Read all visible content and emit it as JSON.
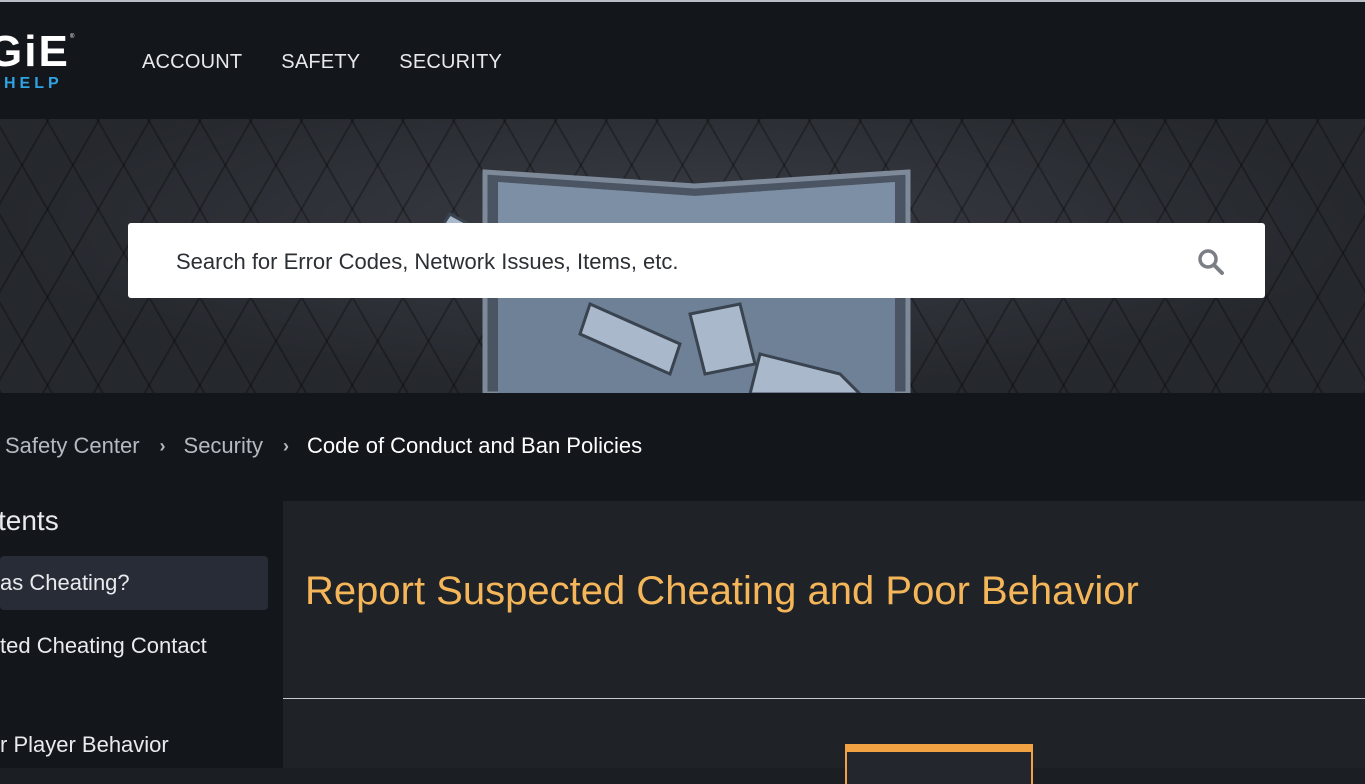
{
  "logo": {
    "main": "GiE",
    "sub": "HELP"
  },
  "nav": {
    "items": [
      "ACCOUNT",
      "SAFETY",
      "SECURITY"
    ]
  },
  "search": {
    "placeholder": "Search for Error Codes, Network Issues, Items, etc.",
    "icon": "search-icon"
  },
  "breadcrumb": {
    "items": [
      "Safety Center",
      "Security"
    ],
    "current": "Code of Conduct and Ban Policies"
  },
  "sidebar": {
    "title": "tents",
    "items": [
      "as Cheating?",
      "ted Cheating Contact",
      "r Player Behavior"
    ]
  },
  "main": {
    "title": "Report Suspected Cheating and Poor Behavior"
  },
  "colors": {
    "accent_title": "#f4b659",
    "logo_help": "#2fa3e3",
    "tab_orange": "#f1a243"
  }
}
